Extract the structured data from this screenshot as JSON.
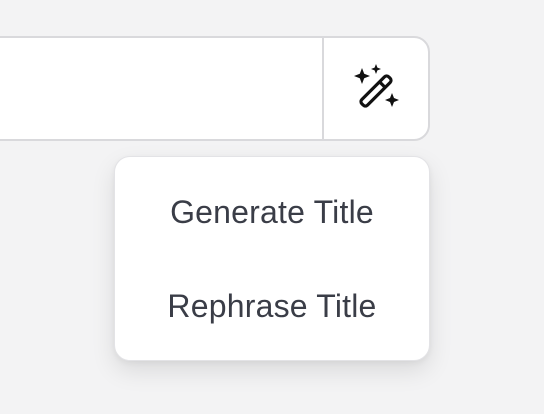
{
  "title_field": {
    "value": "",
    "placeholder": ""
  },
  "magic_button": {
    "icon": "magic-wand-sparkles-icon"
  },
  "menu": {
    "items": [
      {
        "label": "Generate Title"
      },
      {
        "label": "Rephrase Title"
      }
    ]
  },
  "colors": {
    "background": "#f3f3f4",
    "surface": "#ffffff",
    "border": "#d9d9dc",
    "text": "#3a3d47",
    "icon": "#111111"
  }
}
